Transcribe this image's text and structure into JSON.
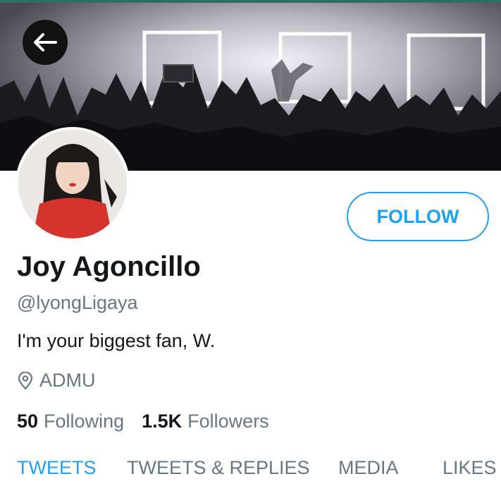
{
  "profile": {
    "name": "Joy Agoncillo",
    "handle": "@lyongLigaya",
    "bio": "I'm your biggest fan, W.",
    "location": "ADMU"
  },
  "actions": {
    "follow_label": "FOLLOW"
  },
  "stats": {
    "following_count": "50",
    "following_label": "Following",
    "followers_count": "1.5K",
    "followers_label": "Followers"
  },
  "tabs": [
    {
      "label": "TWEETS",
      "active": true
    },
    {
      "label": "TWEETS & REPLIES",
      "active": false
    },
    {
      "label": "MEDIA",
      "active": false
    },
    {
      "label": "LIKES",
      "active": false
    }
  ],
  "colors": {
    "accent": "#1da1f2",
    "secondary_text": "#657786",
    "primary_text": "#14171a"
  },
  "icons": {
    "back": "arrow-left-icon",
    "location": "location-pin-icon"
  }
}
